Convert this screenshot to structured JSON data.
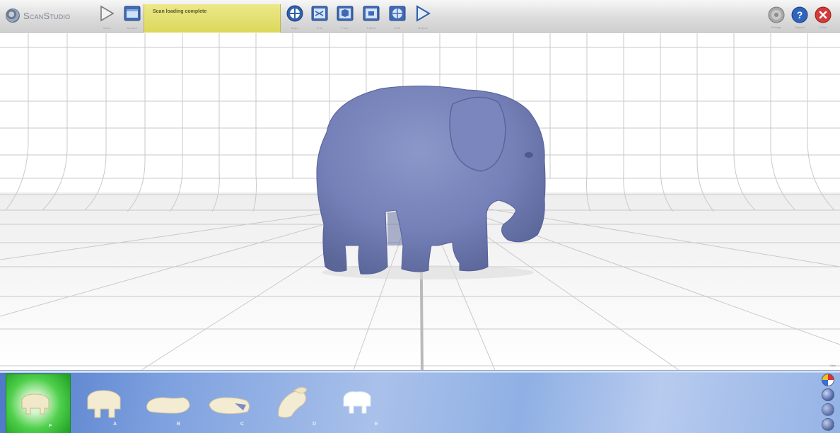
{
  "app": {
    "name": "ScanStudio",
    "status_message": "Scan loading complete"
  },
  "toolbar": {
    "left_buttons": [
      {
        "id": "scan",
        "label": "Scan",
        "icon": "play-outline-icon"
      },
      {
        "id": "browse",
        "label": "Browse",
        "icon": "folder-icon"
      }
    ],
    "workflow_buttons": [
      {
        "id": "align",
        "label": "Align",
        "icon": "align-icon"
      },
      {
        "id": "trim",
        "label": "Trim",
        "icon": "trim-icon"
      },
      {
        "id": "fuse",
        "label": "Fuse",
        "icon": "fuse-icon"
      },
      {
        "id": "polish",
        "label": "Polish",
        "icon": "polish-icon"
      },
      {
        "id": "cad",
        "label": "CAD",
        "icon": "cad-icon"
      },
      {
        "id": "output",
        "label": "Output",
        "icon": "play-icon"
      }
    ],
    "right_buttons": [
      {
        "id": "settings",
        "label": "Settings",
        "icon": "settings-icon"
      },
      {
        "id": "support",
        "label": "Support",
        "icon": "help-icon"
      },
      {
        "id": "close",
        "label": "Close",
        "icon": "close-icon"
      }
    ]
  },
  "viewport": {
    "model": "elephant scan",
    "model_color": "#7480b7",
    "grid_color": "#c9c9c9"
  },
  "thumbnails": [
    {
      "tag": "F",
      "selected": true
    },
    {
      "tag": "A",
      "selected": false
    },
    {
      "tag": "B",
      "selected": false
    },
    {
      "tag": "C",
      "selected": false
    },
    {
      "tag": "D",
      "selected": false
    },
    {
      "tag": "E",
      "selected": false
    }
  ],
  "view_panel": {
    "label": "View",
    "buttons": [
      "color-view-icon",
      "shaded-view-icon",
      "points-view-icon",
      "wireframe-view-icon"
    ]
  }
}
